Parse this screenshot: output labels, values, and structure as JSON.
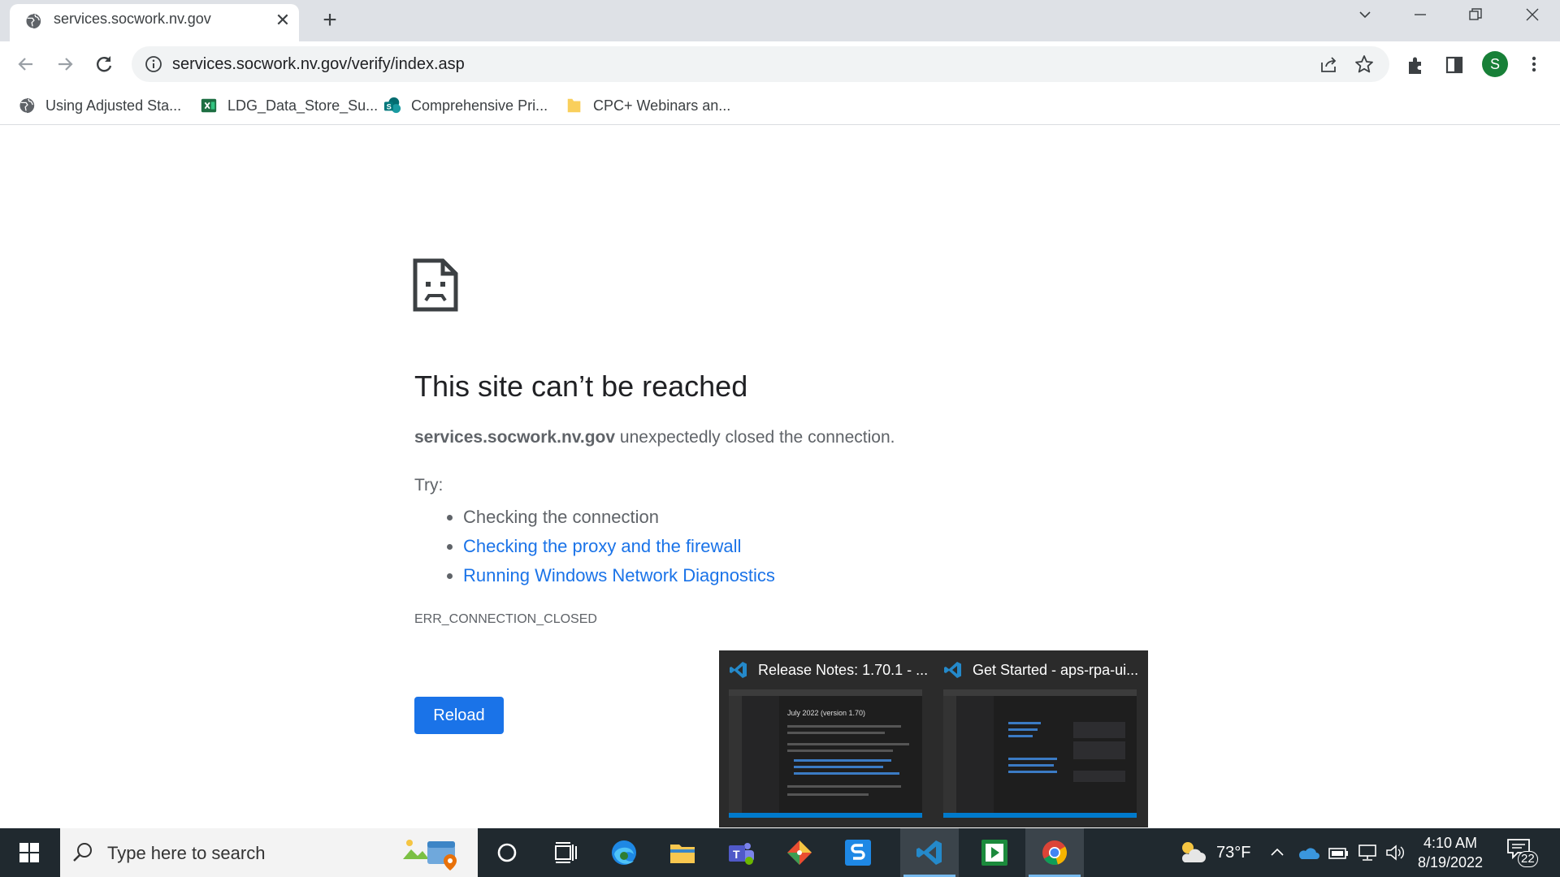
{
  "tab": {
    "title": "services.socwork.nv.gov"
  },
  "omnibox": {
    "url": "services.socwork.nv.gov/verify/index.asp"
  },
  "profile": {
    "initial": "S"
  },
  "bookmarks": [
    {
      "label": "Using Adjusted Sta...",
      "icon": "globe-icon"
    },
    {
      "label": "LDG_Data_Store_Su...",
      "icon": "excel-icon"
    },
    {
      "label": "Comprehensive Pri...",
      "icon": "sharepoint-icon"
    },
    {
      "label": "CPC+ Webinars an...",
      "icon": "folder-icon"
    }
  ],
  "error": {
    "title": "This site can’t be reached",
    "host": "services.socwork.nv.gov",
    "message": " unexpectedly closed the connection.",
    "try_label": "Try:",
    "suggestions": [
      {
        "text": "Checking the connection",
        "link": false
      },
      {
        "text": "Checking the proxy and the firewall",
        "link": true
      },
      {
        "text": "Running Windows Network Diagnostics",
        "link": true
      }
    ],
    "code": "ERR_CONNECTION_CLOSED",
    "reload_label": "Reload"
  },
  "preview": {
    "windows": [
      {
        "title": "Release Notes: 1.70.1 - ...",
        "heading": "July 2022 (version 1.70)"
      },
      {
        "title": "Get Started - aps-rpa-ui..."
      }
    ]
  },
  "taskbar": {
    "search_placeholder": "Type here to search",
    "weather": "73°F",
    "time": "4:10 AM",
    "date": "8/19/2022",
    "notifications": "22"
  },
  "colors": {
    "link": "#1a73e8",
    "reload_bg": "#1a73e8",
    "tab_strip": "#dee1e6",
    "taskbar": "#20292f"
  }
}
